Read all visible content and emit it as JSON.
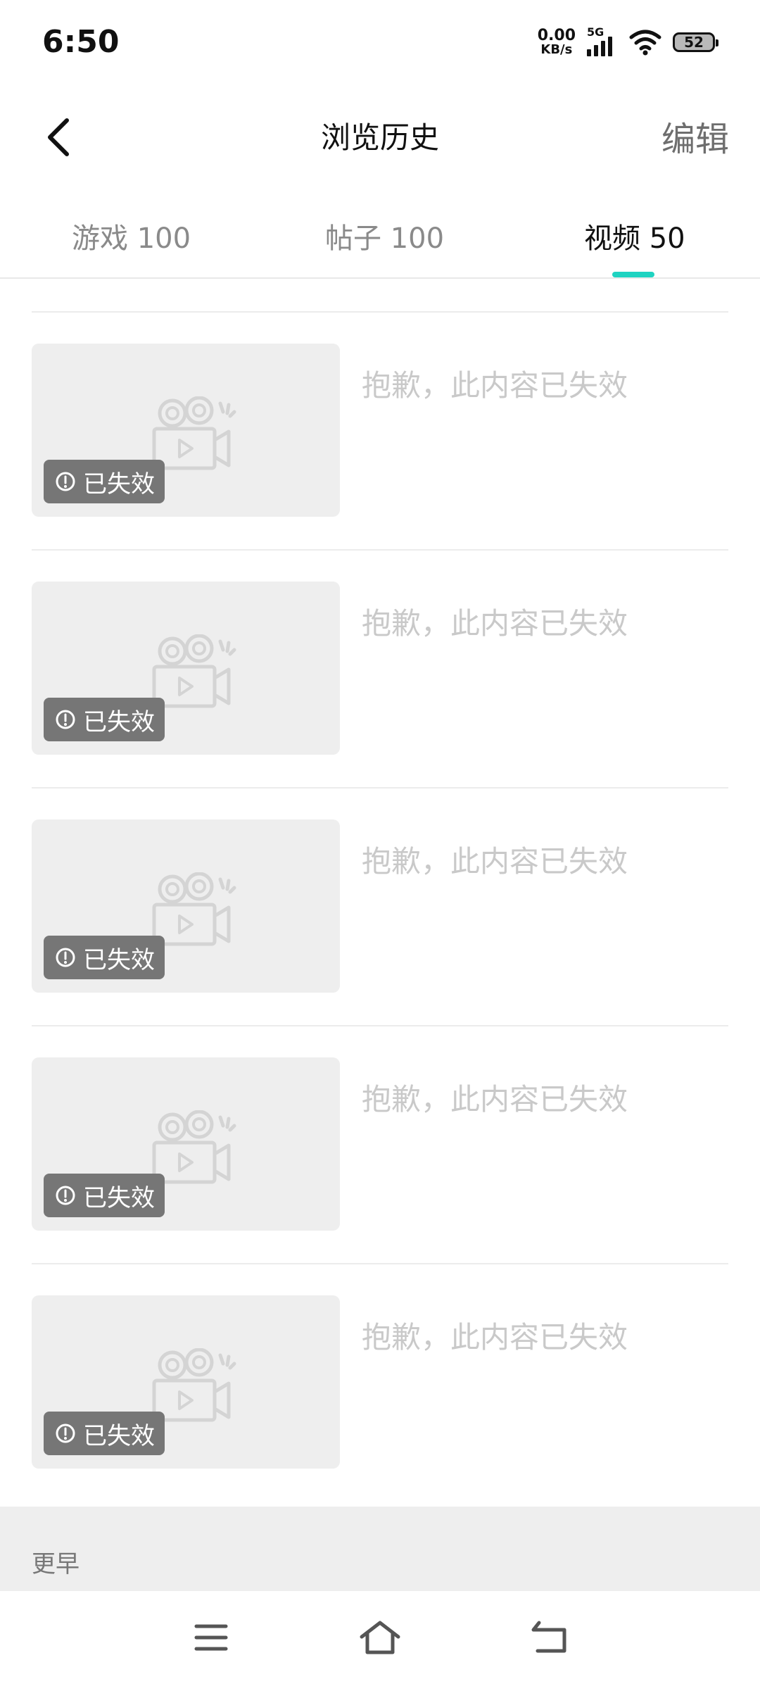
{
  "status": {
    "time": "6:50",
    "net_speed_value": "0.00",
    "net_speed_unit": "KB/s",
    "signal_label": "5G",
    "battery": "52"
  },
  "header": {
    "title": "浏览历史",
    "edit_label": "编辑",
    "back_icon": "back-arrow-icon"
  },
  "tabs": [
    {
      "label": "游戏 100",
      "active": false
    },
    {
      "label": "帖子 100",
      "active": false
    },
    {
      "label": "视频 50",
      "active": true
    }
  ],
  "colors": {
    "accent": "#1fd3c1",
    "badge_bg": "#767676",
    "thumb_bg": "#eeeeee"
  },
  "items": [
    {
      "title": "抱歉，此内容已失效",
      "badge": "已失效"
    },
    {
      "title": "抱歉，此内容已失效",
      "badge": "已失效"
    },
    {
      "title": "抱歉，此内容已失效",
      "badge": "已失效"
    },
    {
      "title": "抱歉，此内容已失效",
      "badge": "已失效"
    },
    {
      "title": "抱歉，此内容已失效",
      "badge": "已失效"
    }
  ],
  "more_section": {
    "label": "更早"
  },
  "nav": {
    "menu_icon": "menu-icon",
    "home_icon": "home-icon",
    "back_icon": "back-icon"
  }
}
